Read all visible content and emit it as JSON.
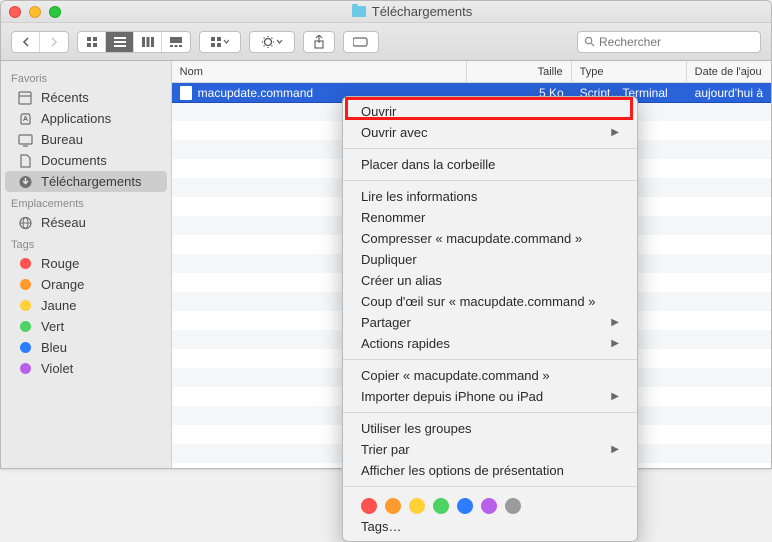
{
  "window": {
    "title": "Téléchargements"
  },
  "search": {
    "placeholder": "Rechercher"
  },
  "sidebar": {
    "sections": {
      "favoris": {
        "label": "Favoris",
        "items": [
          {
            "label": "Récents"
          },
          {
            "label": "Applications"
          },
          {
            "label": "Bureau"
          },
          {
            "label": "Documents"
          },
          {
            "label": "Téléchargements"
          }
        ]
      },
      "emplacements": {
        "label": "Emplacements",
        "items": [
          {
            "label": "Réseau"
          }
        ]
      },
      "tags": {
        "label": "Tags",
        "items": [
          {
            "label": "Rouge",
            "color": "#ff5350"
          },
          {
            "label": "Orange",
            "color": "#ff9a2d"
          },
          {
            "label": "Jaune",
            "color": "#ffd23a"
          },
          {
            "label": "Vert",
            "color": "#4cd363"
          },
          {
            "label": "Bleu",
            "color": "#2c7dff"
          },
          {
            "label": "Violet",
            "color": "#b960e8"
          }
        ]
      }
    }
  },
  "columns": {
    "name": "Nom",
    "size": "Taille",
    "type": "Type",
    "date": "Date de l'ajou"
  },
  "files": [
    {
      "name": "macupdate.command",
      "size": "5 Ko",
      "type": "Script…Terminal",
      "date": "aujourd'hui à"
    }
  ],
  "context_menu": {
    "items": [
      {
        "label": "Ouvrir",
        "sub": false
      },
      {
        "label": "Ouvrir avec",
        "sub": true
      },
      {
        "sep": true
      },
      {
        "label": "Placer dans la corbeille",
        "sub": false
      },
      {
        "sep": true
      },
      {
        "label": "Lire les informations",
        "sub": false
      },
      {
        "label": "Renommer",
        "sub": false
      },
      {
        "label": "Compresser « macupdate.command »",
        "sub": false
      },
      {
        "label": "Dupliquer",
        "sub": false
      },
      {
        "label": "Créer un alias",
        "sub": false
      },
      {
        "label": "Coup d'œil sur « macupdate.command »",
        "sub": false
      },
      {
        "label": "Partager",
        "sub": true
      },
      {
        "label": "Actions rapides",
        "sub": true
      },
      {
        "sep": true
      },
      {
        "label": "Copier « macupdate.command »",
        "sub": false
      },
      {
        "label": "Importer depuis iPhone ou iPad",
        "sub": true
      },
      {
        "sep": true
      },
      {
        "label": "Utiliser les groupes",
        "sub": false
      },
      {
        "label": "Trier par",
        "sub": true
      },
      {
        "label": "Afficher les options de présentation",
        "sub": false
      }
    ],
    "tag_colors": [
      "#ff5350",
      "#ff9a2d",
      "#ffd23a",
      "#4cd363",
      "#2c7dff",
      "#b960e8",
      "#9b9b9b"
    ],
    "tags_label": "Tags…"
  }
}
